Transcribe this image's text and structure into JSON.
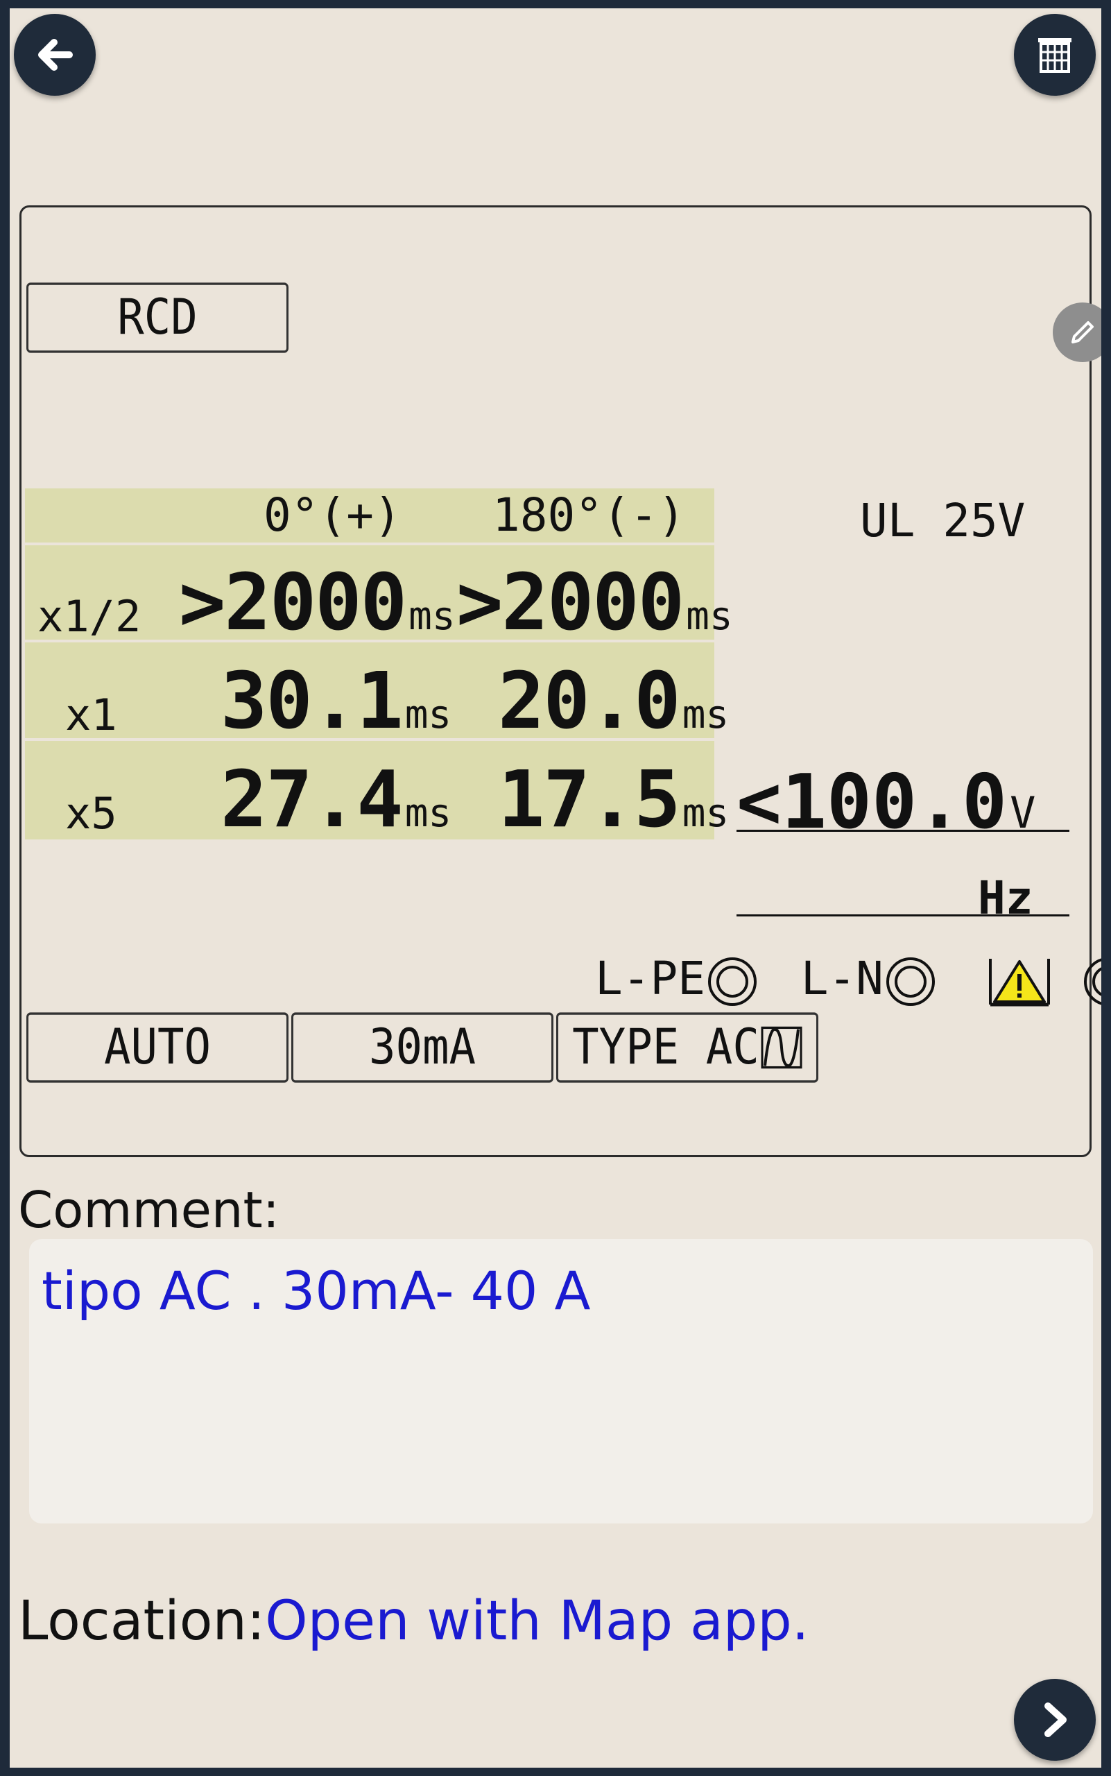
{
  "rcd_label": "RCD",
  "table": {
    "header_pos": "0°(+)",
    "header_neg": "180°(-)",
    "rows": [
      {
        "label": "x1/2",
        "pos_value": ">2000",
        "pos_unit": "ms",
        "neg_value": ">2000",
        "neg_unit": "ms"
      },
      {
        "label": "x1",
        "pos_value": "30.1",
        "pos_unit": "ms",
        "neg_value": "20.0",
        "neg_unit": "ms"
      },
      {
        "label": "x5",
        "pos_value": "27.4",
        "pos_unit": "ms",
        "neg_value": "17.5",
        "neg_unit": "ms"
      }
    ]
  },
  "ul_label": "UL 25V",
  "voltage": {
    "value": "<100.0",
    "unit": "V"
  },
  "frequency_unit": "Hz",
  "indicators": {
    "lpe": "L-PE",
    "ln": "L-N"
  },
  "settings": {
    "mode": "AUTO",
    "current": "30mA",
    "type": "TYPE AC"
  },
  "comment": {
    "label": "Comment:",
    "value": "tipo AC . 30mA- 40 A"
  },
  "location": {
    "label": "Location:",
    "link": "Open with Map app."
  },
  "colors": {
    "table_bg": "#dcdcae",
    "screen_bg": "#ebe4da",
    "link": "#1a1ad0",
    "button_bg": "#1f2b3a"
  }
}
